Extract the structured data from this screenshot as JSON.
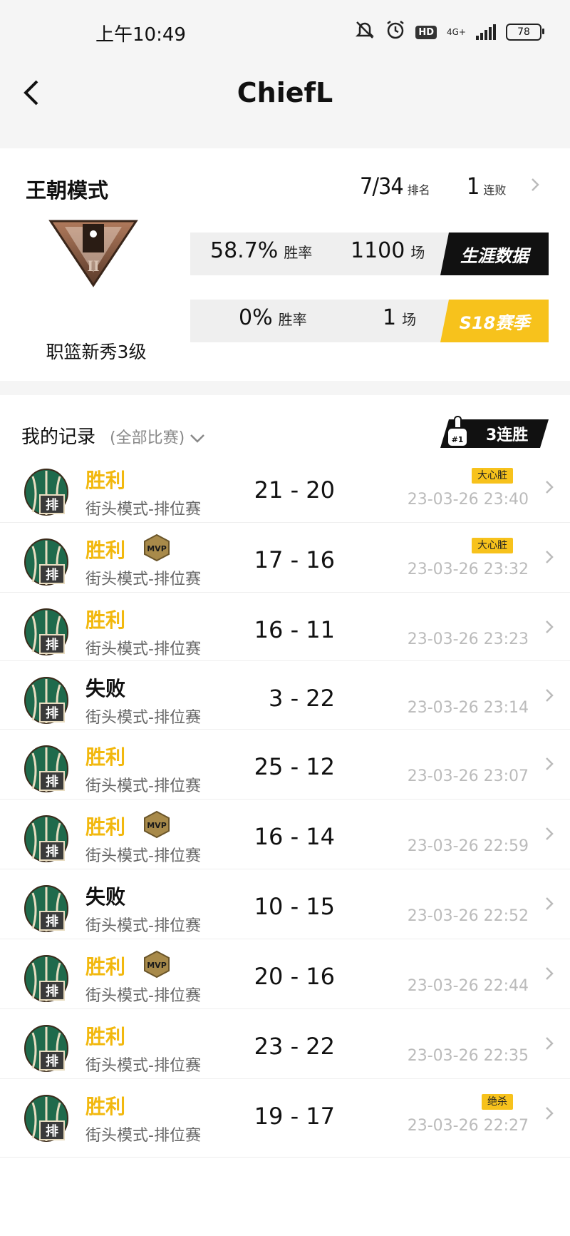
{
  "status": {
    "time": "上午10:49",
    "net": "4G+",
    "hd": "HD",
    "battery": "78"
  },
  "nav": {
    "title": "ChiefL"
  },
  "mode": {
    "title": "王朝模式",
    "rank": "7/34",
    "rank_label": "排名",
    "streak": "1",
    "streak_label": "连败",
    "badge_name": "职篮新秀3级",
    "career": {
      "pct": "58.7%",
      "pct_label": "胜率",
      "games": "1100",
      "games_label": "场",
      "button": "生涯数据"
    },
    "season": {
      "pct": "0%",
      "pct_label": "胜率",
      "games": "1",
      "games_label": "场",
      "button": "S18赛季"
    }
  },
  "records": {
    "title": "我的记录",
    "filter": "(全部比赛)",
    "win_streak": "3连胜",
    "rows": [
      {
        "result": "胜利",
        "mode": "街头模式-排位赛",
        "score": "21 - 20",
        "time": "23-03-26 23:40",
        "tag": "大心脏",
        "mvp": ""
      },
      {
        "result": "胜利",
        "mode": "街头模式-排位赛",
        "score": "17 - 16",
        "time": "23-03-26 23:32",
        "tag": "大心脏",
        "mvp": "MVP"
      },
      {
        "result": "胜利",
        "mode": "街头模式-排位赛",
        "score": "16 - 11",
        "time": "23-03-26 23:23",
        "tag": "",
        "mvp": ""
      },
      {
        "result": "失败",
        "mode": "街头模式-排位赛",
        "score": "3 - 22",
        "time": "23-03-26 23:14",
        "tag": "",
        "mvp": ""
      },
      {
        "result": "胜利",
        "mode": "街头模式-排位赛",
        "score": "25 - 12",
        "time": "23-03-26 23:07",
        "tag": "",
        "mvp": ""
      },
      {
        "result": "胜利",
        "mode": "街头模式-排位赛",
        "score": "16 - 14",
        "time": "23-03-26 22:59",
        "tag": "",
        "mvp": "MVP"
      },
      {
        "result": "失败",
        "mode": "街头模式-排位赛",
        "score": "10 - 15",
        "time": "23-03-26 22:52",
        "tag": "",
        "mvp": ""
      },
      {
        "result": "胜利",
        "mode": "街头模式-排位赛",
        "score": "20 - 16",
        "time": "23-03-26 22:44",
        "tag": "",
        "mvp": "MVP"
      },
      {
        "result": "胜利",
        "mode": "街头模式-排位赛",
        "score": "23 - 22",
        "time": "23-03-26 22:35",
        "tag": "",
        "mvp": ""
      },
      {
        "result": "胜利",
        "mode": "街头模式-排位赛",
        "score": "19 - 17",
        "time": "23-03-26 22:27",
        "tag": "绝杀",
        "mvp": ""
      }
    ]
  },
  "colors": {
    "win": "#f2b80e",
    "accent": "#f7c21c",
    "logo_green": "#1f6a4c"
  }
}
